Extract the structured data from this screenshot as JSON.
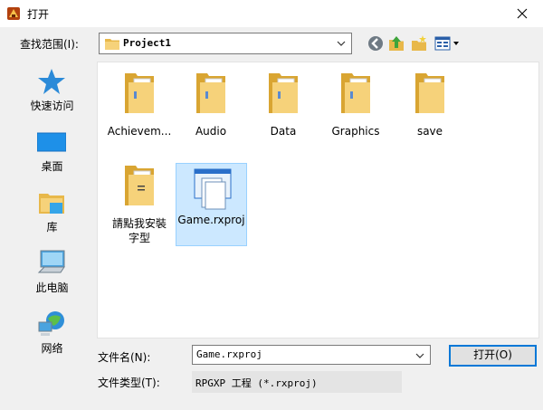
{
  "window": {
    "title": "打开"
  },
  "toolbar": {
    "look_in_label": "查找范围(I):",
    "look_in_value": "Project1",
    "buttons": [
      "back-icon",
      "up-folder-icon",
      "new-folder-icon",
      "view-menu-icon"
    ]
  },
  "places": [
    {
      "label": "快速访问",
      "icon": "star-icon"
    },
    {
      "label": "桌面",
      "icon": "desktop-icon"
    },
    {
      "label": "库",
      "icon": "library-icon"
    },
    {
      "label": "此电脑",
      "icon": "computer-icon"
    },
    {
      "label": "网络",
      "icon": "network-icon"
    }
  ],
  "files": [
    {
      "name": "Achievem...",
      "type": "folder"
    },
    {
      "name": "Audio",
      "type": "folder"
    },
    {
      "name": "Data",
      "type": "folder"
    },
    {
      "name": "Graphics",
      "type": "folder"
    },
    {
      "name": "save",
      "type": "folder"
    },
    {
      "name": "請點我安裝字型",
      "type": "folder"
    },
    {
      "name": "Game.rxproj",
      "type": "project",
      "selected": true
    }
  ],
  "footer": {
    "filename_label": "文件名(N):",
    "filename_value": "Game.rxproj",
    "filetype_label": "文件类型(T):",
    "filetype_value": "RPGXP 工程 (*.rxproj)",
    "open_button": "打开(O)"
  },
  "colors": {
    "selection": "#cce8ff",
    "accent": "#0078d7",
    "folder": "#e8b84a"
  }
}
